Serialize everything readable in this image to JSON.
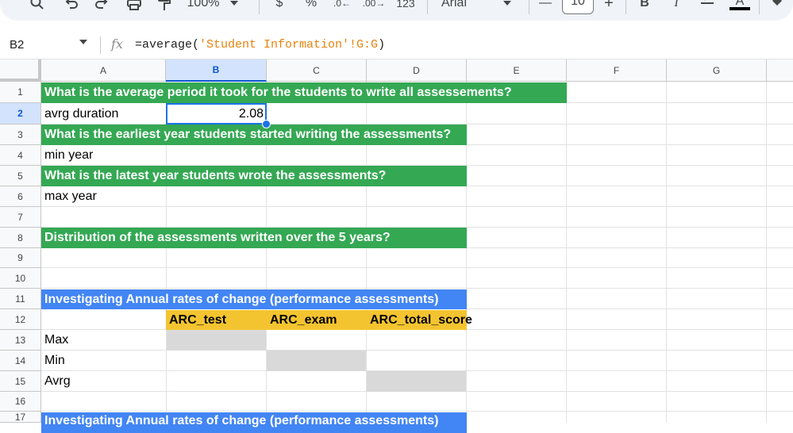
{
  "toolbar": {
    "zoom": "100%",
    "currency": "$",
    "percent": "%",
    "number_format": "123",
    "font": "Arial",
    "font_size": "10",
    "minus": "—",
    "plus": "+",
    "bold": "B",
    "italic": "I",
    "text_color": "A"
  },
  "formula_bar": {
    "cell_ref": "B2",
    "fx": "fx",
    "formula_prefix": "=average(",
    "formula_string": "'Student Information'!G:G",
    "formula_suffix": ")"
  },
  "columns": [
    "A",
    "B",
    "C",
    "D",
    "E",
    "F",
    "G"
  ],
  "rows": [
    "1",
    "2",
    "3",
    "4",
    "5",
    "6",
    "7",
    "8",
    "9",
    "10",
    "11",
    "12",
    "13",
    "14",
    "15",
    "16",
    "17"
  ],
  "cells": {
    "A1": "What is the average period it took for the students to write all assessements?",
    "A2": "avrg duration",
    "B2": "2.08",
    "A3": "What is the earliest year students started writing the assessments?",
    "A4": "min year",
    "A5": "What is the latest year students wrote the assessments?",
    "A6": "max year",
    "A8": "Distribution of the assessments written over the 5 years?",
    "A11": "Investigating Annual rates of change (performance assessments)",
    "B12": "ARC_test",
    "C12": "ARC_exam",
    "D12": "ARC_total_score",
    "A13": "Max",
    "A14": "Min",
    "A15": "Avrg",
    "A17": "Investigating Annual rates of change (performance assessments)"
  },
  "colors": {
    "green": "#34a853",
    "blue": "#4285f4",
    "yellow": "#f4c430",
    "gray": "#d9d9d9",
    "selection": "#1a73e8"
  }
}
